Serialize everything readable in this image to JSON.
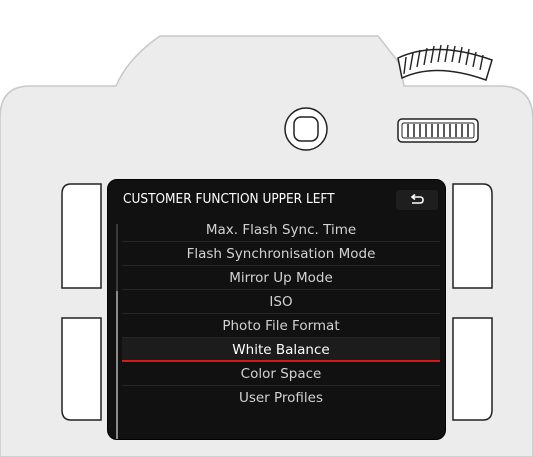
{
  "screen": {
    "title": "CUSTOMER FUNCTION UPPER LEFT",
    "back_icon": "back-arrow-icon",
    "accent_color": "#d21a1a",
    "menu": {
      "items": [
        {
          "label": "Max. Flash Sync. Time",
          "selected": false
        },
        {
          "label": "Flash Synchronisation Mode",
          "selected": false
        },
        {
          "label": "Mirror Up Mode",
          "selected": false
        },
        {
          "label": "ISO",
          "selected": false
        },
        {
          "label": "Photo File Format",
          "selected": false
        },
        {
          "label": "White Balance",
          "selected": true
        },
        {
          "label": "Color Space",
          "selected": false
        },
        {
          "label": "User Profiles",
          "selected": false
        }
      ]
    }
  }
}
